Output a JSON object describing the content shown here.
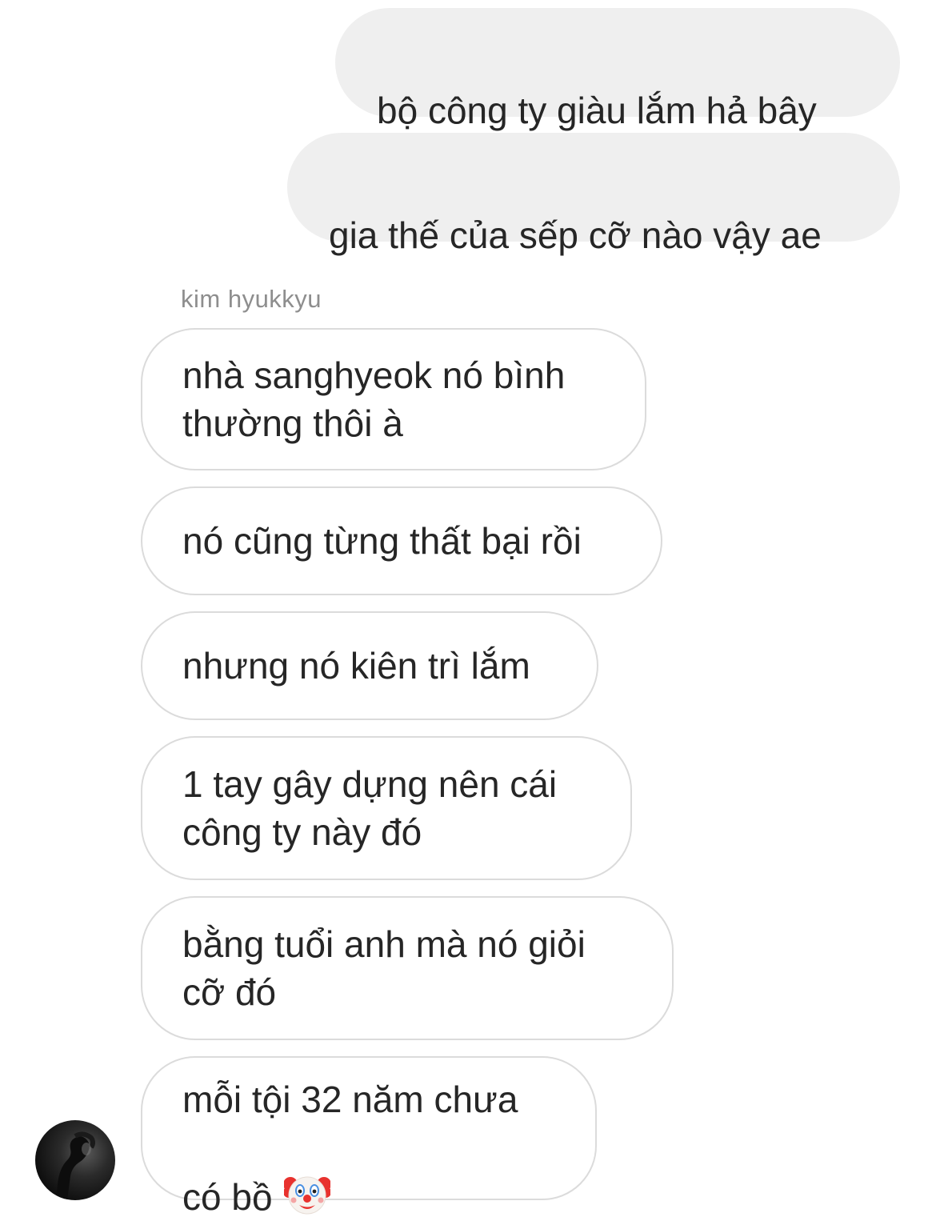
{
  "conversation": {
    "sent_messages": [
      "bộ công ty giàu lắm hả bây",
      "gia thế của sếp cỡ nào vậy ae"
    ],
    "sender_name": "kim hyukkyu",
    "received_messages": [
      "nhà sanghyeok nó bình\nthường thôi à",
      "nó cũng từng thất bại rồi",
      "nhưng nó kiên trì lắm",
      "1 tay gây dựng nên cái\ncông ty này đó",
      "bằng tuổi anh mà nó giỏi\ncỡ đó",
      "mỗi tội 32 năm chưa\ncó bồ"
    ],
    "last_message_emoji": "clown-face-emoji"
  },
  "colors": {
    "sent_bubble_bg": "#efefef",
    "received_bubble_border": "#dbdbdb",
    "text": "#262626",
    "sender_name": "#8e8e8e"
  }
}
